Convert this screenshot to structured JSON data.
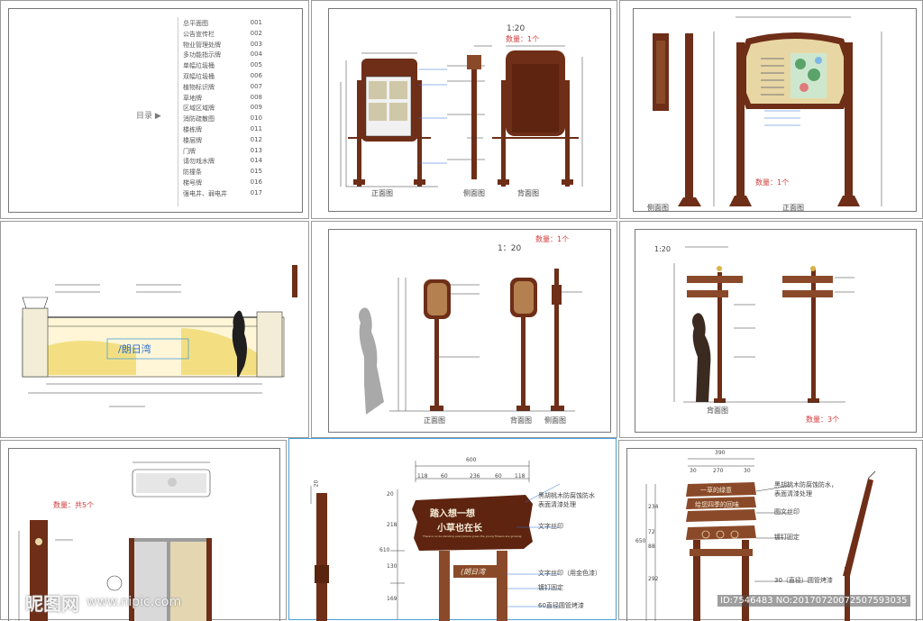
{
  "toc": {
    "heading": "目录 ▶",
    "items": [
      {
        "name": "总平面图",
        "no": "001"
      },
      {
        "name": "公告宣传栏",
        "no": "002"
      },
      {
        "name": "物业管理处牌",
        "no": "003"
      },
      {
        "name": "多功能指示牌",
        "no": "004"
      },
      {
        "name": "单幅垃圾桶",
        "no": "005"
      },
      {
        "name": "双幅垃圾桶",
        "no": "006"
      },
      {
        "name": "植物标识牌",
        "no": "007"
      },
      {
        "name": "草地牌",
        "no": "008"
      },
      {
        "name": "区域区域牌",
        "no": "009"
      },
      {
        "name": "消防疏散图",
        "no": "010"
      },
      {
        "name": "楼栋牌",
        "no": "011"
      },
      {
        "name": "楼层牌",
        "no": "012"
      },
      {
        "name": "门牌",
        "no": "013"
      },
      {
        "name": "请勿戏水牌",
        "no": "014"
      },
      {
        "name": "防撞条",
        "no": "015"
      },
      {
        "name": "梯号牌",
        "no": "016"
      },
      {
        "name": "强电井、弱电井",
        "no": "017"
      }
    ]
  },
  "sheet2": {
    "scale": "1:20",
    "quantity": "数量：1个",
    "views": [
      "正面图",
      "侧面图",
      "背面图"
    ]
  },
  "sheet3": {
    "quantity": "数量：1个",
    "views": [
      "侧面图",
      "正面图"
    ]
  },
  "sheet5": {
    "scale": "1：20",
    "quantity": "数量：1个",
    "views": [
      "正面图",
      "背面图",
      "侧面图"
    ]
  },
  "sheet6": {
    "scale": "1:20",
    "quantity": "数量：3个",
    "views": [
      "背面图"
    ]
  },
  "sheet7": {
    "quantity": "数量：共5个"
  },
  "sheet8": {
    "dims_top": [
      "600",
      "118",
      "60",
      "236",
      "60",
      "118"
    ],
    "dims_left": [
      "20",
      "218",
      "610",
      "130",
      "169"
    ],
    "sign_line1": "踏入想一想",
    "sign_line2": "小草也在长",
    "sign_small": "There is no lie standing everywhere grass the young flowers are growing",
    "logo": "(朗日湾",
    "notes": [
      "黑胡桃木防腐蚀防水",
      "表面清漆处理",
      "文字丝印",
      "文字丝印（用金色漆）",
      "镀钉固定",
      "60直径圆管烤漆"
    ],
    "left_dim": "20"
  },
  "sheet9": {
    "dims_top": [
      "390",
      "30",
      "270",
      "30"
    ],
    "dims_left": [
      "650",
      "234",
      "72",
      "88",
      "292"
    ],
    "sign_lines": [
      "一草的绿意",
      "给您四季的回味"
    ],
    "notes": [
      "黑胡桃木防腐蚀防水，",
      "表面清漆处理",
      "图文丝印",
      "镀钉固定",
      "30（直径）圆管烤漆"
    ]
  },
  "watermark": {
    "logo": "昵图网",
    "url": "www.nipic.com",
    "id": "ID:7546483 NO:20170720072507593035"
  },
  "colors": {
    "wood": "#6e2e17",
    "wood_light": "#b5804f",
    "board": "#e8d7a4",
    "yellow": "#f3df82",
    "red": "#d43a3a"
  }
}
